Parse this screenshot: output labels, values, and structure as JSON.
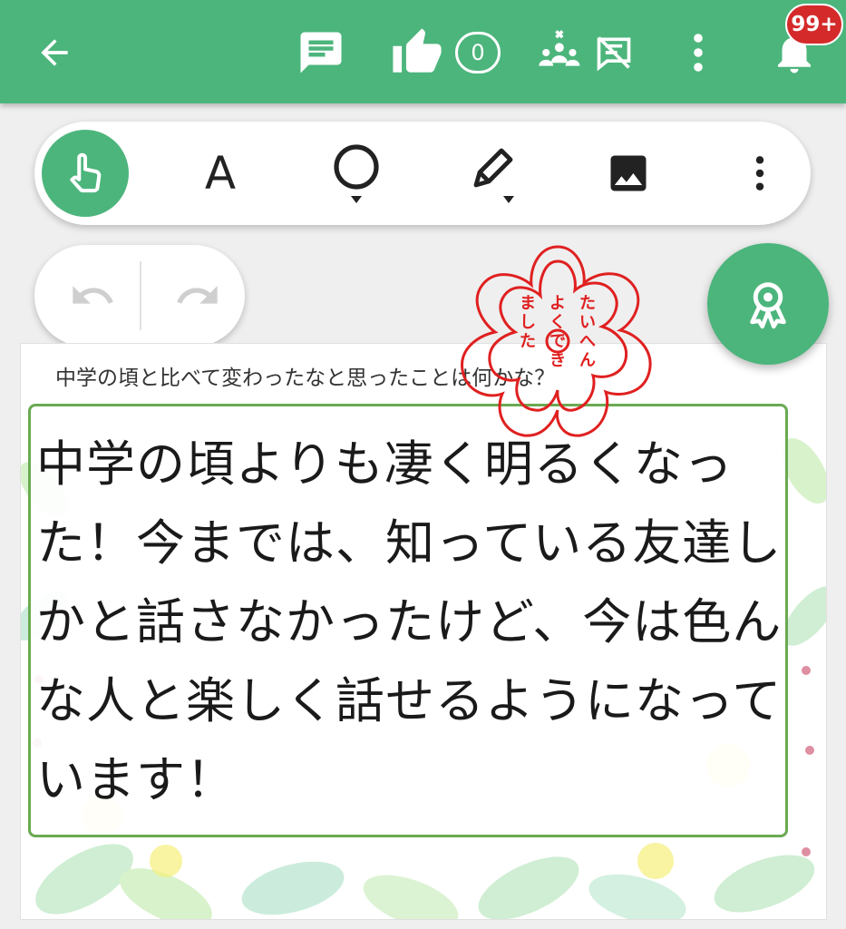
{
  "appbar": {
    "like_count": "0",
    "notification_badge": "99+",
    "icons": [
      "back-arrow-icon",
      "comment-icon",
      "thumbs-up-icon",
      "group-remove-icon",
      "comments-off-icon",
      "more-vert-icon",
      "bell-icon"
    ],
    "color": "#4cb57c"
  },
  "toolbar": {
    "text_tool_label": "A",
    "icons": [
      "pointer-hand-icon",
      "text-tool-icon",
      "shape-circle-icon",
      "pencil-icon",
      "image-icon",
      "more-vert-icon"
    ]
  },
  "history": {
    "icons": [
      "undo-icon",
      "redo-icon"
    ]
  },
  "stamp": {
    "text": "たいへんよくできました",
    "color": "#e02020"
  },
  "card": {
    "question": "中学の頃と比べて変わったなと思ったことは何かな？",
    "answer": "中学の頃よりも凄く明るくなった！今までは、知っている友達しかと話さなかったけど、今は色んな人と楽しく話せるようになっています！",
    "border_color": "#6aaa52"
  }
}
